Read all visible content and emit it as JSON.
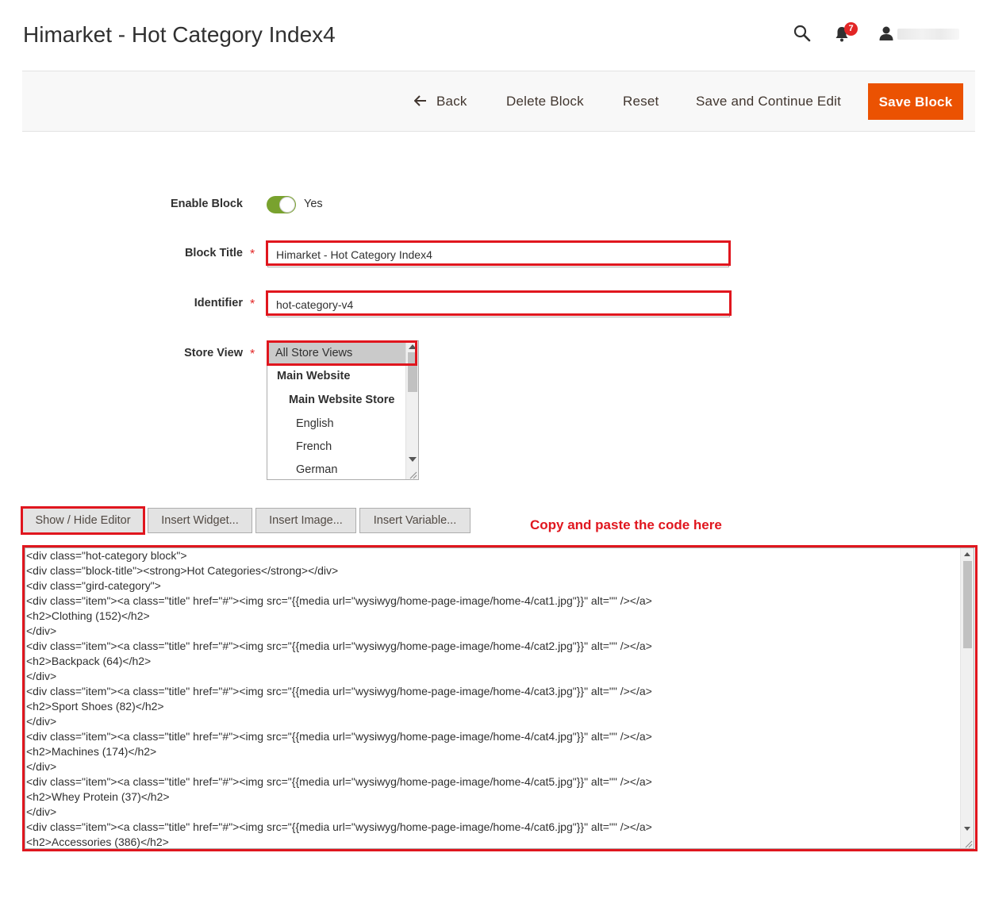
{
  "page": {
    "title": "Himarket - Hot Category Index4"
  },
  "header": {
    "notifications_count": "7",
    "user_name_hidden": true
  },
  "toolbar": {
    "back_label": "Back",
    "delete_label": "Delete Block",
    "reset_label": "Reset",
    "save_continue_label": "Save and Continue Edit",
    "save_label": "Save Block",
    "save_color": "#eb5202"
  },
  "form": {
    "enable_block": {
      "label": "Enable Block",
      "value_label": "Yes",
      "enabled": true
    },
    "block_title": {
      "label": "Block Title",
      "value": "Himarket - Hot Category Index4"
    },
    "identifier": {
      "label": "Identifier",
      "value": "hot-category-v4"
    },
    "store_view": {
      "label": "Store View",
      "options": [
        {
          "label": "All Store Views",
          "selected": true
        },
        {
          "label": "Main Website"
        },
        {
          "label": "Main Website Store"
        },
        {
          "label": "English"
        },
        {
          "label": "French"
        },
        {
          "label": "German"
        }
      ]
    }
  },
  "editor": {
    "show_hide_label": "Show / Hide Editor",
    "insert_widget_label": "Insert Widget...",
    "insert_image_label": "Insert Image...",
    "insert_variable_label": "Insert Variable...",
    "annotation": "Copy and paste the code here",
    "annotation_color": "#e0161e",
    "content_lines": [
      "<div class=\"hot-category block\">",
      "<div class=\"block-title\"><strong>Hot Categories</strong></div>",
      "<div class=\"gird-category\">",
      "<div class=\"item\"><a class=\"title\" href=\"#\"><img src=\"{{media url=\"wysiwyg/home-page-image/home-4/cat1.jpg\"}}\" alt=\"\" /></a>",
      "<h2>Clothing (152)</h2>",
      "</div>",
      "<div class=\"item\"><a class=\"title\" href=\"#\"><img src=\"{{media url=\"wysiwyg/home-page-image/home-4/cat2.jpg\"}}\" alt=\"\" /></a>",
      "<h2>Backpack (64)</h2>",
      "</div>",
      "<div class=\"item\"><a class=\"title\" href=\"#\"><img src=\"{{media url=\"wysiwyg/home-page-image/home-4/cat3.jpg\"}}\" alt=\"\" /></a>",
      "<h2>Sport Shoes (82)</h2>",
      "</div>",
      "<div class=\"item\"><a class=\"title\" href=\"#\"><img src=\"{{media url=\"wysiwyg/home-page-image/home-4/cat4.jpg\"}}\" alt=\"\" /></a>",
      "<h2>Machines (174)</h2>",
      "</div>",
      "<div class=\"item\"><a class=\"title\" href=\"#\"><img src=\"{{media url=\"wysiwyg/home-page-image/home-4/cat5.jpg\"}}\" alt=\"\" /></a>",
      "<h2>Whey Protein (37)</h2>",
      "</div>",
      "<div class=\"item\"><a class=\"title\" href=\"#\"><img src=\"{{media url=\"wysiwyg/home-page-image/home-4/cat6.jpg\"}}\" alt=\"\" /></a>",
      "<h2>Accessories (386)</h2>"
    ]
  }
}
